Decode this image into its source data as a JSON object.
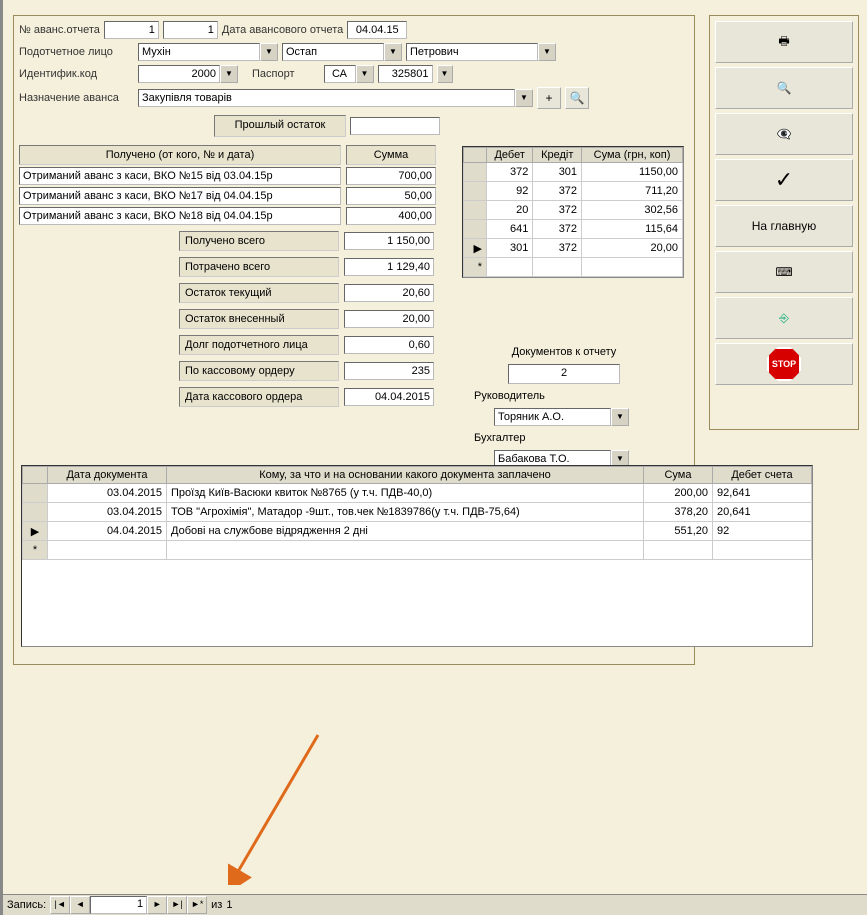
{
  "header": {
    "report_no_label": "№ аванс.отчета",
    "report_no_1": "1",
    "report_no_2": "1",
    "date_label": "Дата авансового отчета",
    "date": "04.04.15",
    "person_label": "Подотчетное лицо",
    "last_name": "Мухін",
    "first_name": "Остап",
    "patronymic": "Петрович",
    "id_label": "Идентифик.код",
    "id_code": "2000",
    "passport_label": "Паспорт",
    "passport_series": "СА",
    "passport_no": "325801",
    "purpose_label": "Назначение аванса",
    "purpose": "Закупівля товарів",
    "plus": "+",
    "prev_balance_label": "Прошлый остаток",
    "prev_balance": ""
  },
  "received": {
    "col_who": "Получено (от кого, № и дата)",
    "col_sum": "Сумма",
    "rows": [
      {
        "who": "Отриманий аванс з каси, ВКО №15 від 03.04.15р",
        "sum": "700,00"
      },
      {
        "who": "Отриманий аванс з каси, ВКО №17 від 04.04.15р",
        "sum": "50,00"
      },
      {
        "who": "Отриманий аванс з каси, ВКО №18 від 04.04.15р",
        "sum": "400,00"
      }
    ]
  },
  "totals": {
    "received_total_label": "Получено всего",
    "received_total": "1 150,00",
    "spent_total_label": "Потрачено всего",
    "spent_total": "1 129,40",
    "curr_balance_label": "Остаток текущий",
    "curr_balance": "20,60",
    "deposited_label": "Остаток внесенный",
    "deposited": "20,00",
    "debt_label": "Долг подотчетного лица",
    "debt": "0,60",
    "cash_order_label": "По кассовому ордеру",
    "cash_order": "235",
    "cash_order_date_label": "Дата кассового ордера",
    "cash_order_date": "04.04.2015"
  },
  "dk_grid": {
    "headers": {
      "debit": "Дебет",
      "credit": "Кредіт",
      "sum": "Сума (грн, коп)"
    },
    "rows": [
      {
        "d": "372",
        "c": "301",
        "s": "1150,00"
      },
      {
        "d": "92",
        "c": "372",
        "s": "711,20"
      },
      {
        "d": "20",
        "c": "372",
        "s": "302,56"
      },
      {
        "d": "641",
        "c": "372",
        "s": "115,64"
      },
      {
        "d": "301",
        "c": "372",
        "s": "20,00"
      }
    ]
  },
  "docs": {
    "label": "Документов к отчету",
    "count": "2",
    "manager_label": "Руководитель",
    "manager": "Торяник А.О.",
    "accountant_label": "Бухгалтер",
    "accountant": "Бабакова Т.О."
  },
  "detail": {
    "headers": {
      "date": "Дата документа",
      "desc": "Кому, за что и на основании какого документа заплачено",
      "sum": "Сума",
      "debit": "Дебет счета"
    },
    "rows": [
      {
        "date": "03.04.2015",
        "desc": "Проїзд Київ-Васюки квиток №8765 (у т.ч. ПДВ-40,0)",
        "sum": "200,00",
        "debit": "92,641"
      },
      {
        "date": "03.04.2015",
        "desc": "ТОВ \"Агрохімія\", Матадор -9шт., тов.чек №1839786(у т.ч. ПДВ-75,64)",
        "sum": "378,20",
        "debit": "20,641"
      },
      {
        "date": "04.04.2015",
        "desc": "Добові на службове відрядження 2 дні",
        "sum": "551,20",
        "debit": "92"
      }
    ]
  },
  "sidebar": {
    "print": "🖶",
    "search": "🔍",
    "binoc": "🔭",
    "check": "✓",
    "home": "На главную",
    "calc": "⌨",
    "exit": "⎘",
    "stop": "STOP"
  },
  "nav": {
    "label": "Запись:",
    "first": "|◄",
    "prev": "◄",
    "pos": "1",
    "next": "►",
    "last": "►|",
    "new": "►*",
    "of_label": "из",
    "of": "1"
  }
}
